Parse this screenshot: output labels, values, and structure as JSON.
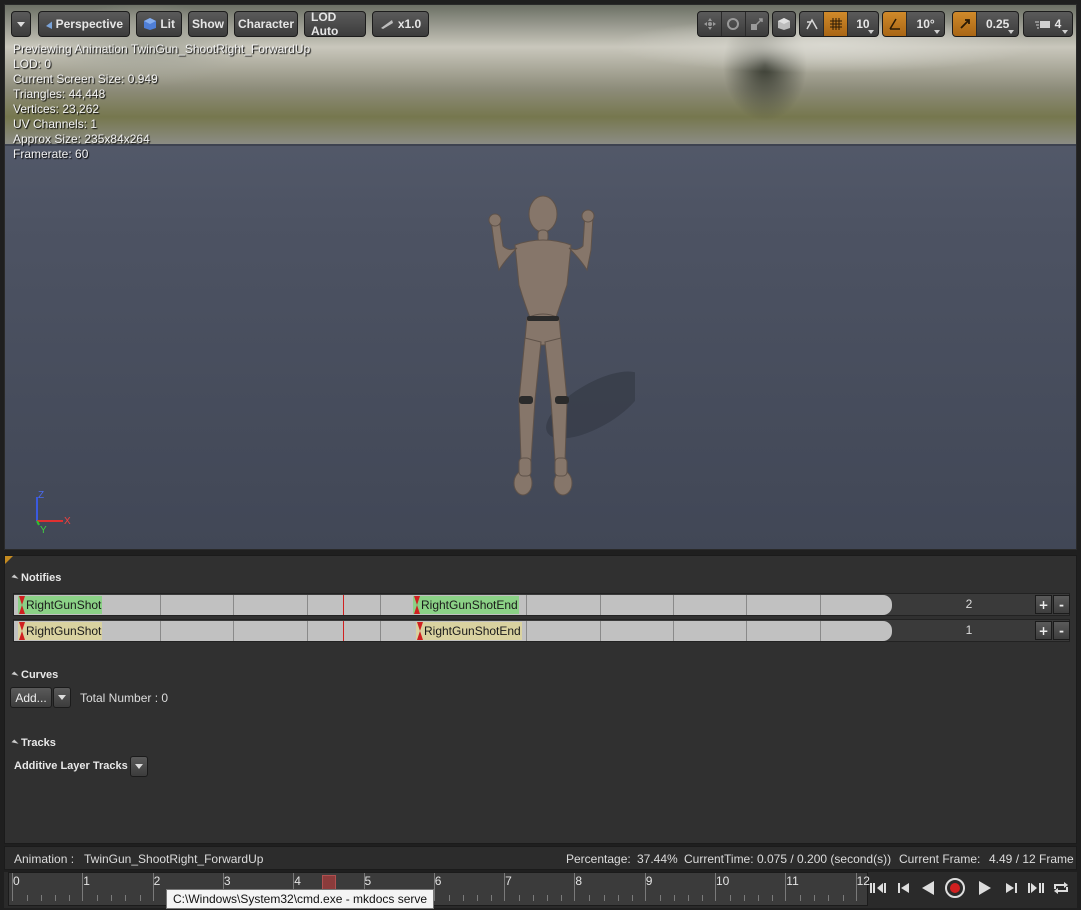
{
  "toolbar": {
    "menu_label": "",
    "perspective_label": "Perspective",
    "lit_label": "Lit",
    "show_label": "Show",
    "character_label": "Character",
    "lod_label": "LOD Auto",
    "speed_label": "x1.0",
    "grid_snap_value": "10",
    "rotation_snap_value": "10°",
    "scale_snap_value": "0.25",
    "camera_speed_value": "4"
  },
  "info": {
    "line1": "Previewing Animation TwinGun_ShootRight_ForwardUp",
    "line2": "LOD: 0",
    "line3": "Current Screen Size: 0.949",
    "line4": "Triangles: 44,448",
    "line5": "Vertices: 23,262",
    "line6": "UV Channels: 1",
    "line7": "Approx Size: 235x84x264",
    "line8": "Framerate: 60"
  },
  "axis": {
    "z": "Z",
    "x": "X",
    "y": "Y"
  },
  "notifies": {
    "title": "Notifies",
    "tracks": [
      {
        "start_label": "RightGunShot",
        "end_label": "RightGunShotEnd",
        "number": "2",
        "color": "#8bd186"
      },
      {
        "start_label": "RightGunShot",
        "end_label": "RightGunShotEnd",
        "number": "1",
        "color": "#d9d2a0"
      }
    ],
    "add_symbol": "+",
    "remove_symbol": "-"
  },
  "curves": {
    "title": "Curves",
    "add_label": "Add...",
    "total_label": "Total Number : 0"
  },
  "tracks": {
    "title": "Tracks",
    "additive_label": "Additive Layer Tracks"
  },
  "status": {
    "animation_label": "Animation :",
    "animation_name": "TwinGun_ShootRight_ForwardUp",
    "percentage_label": "Percentage:",
    "percentage_value": "37.44%",
    "time_label": "CurrentTime:",
    "time_value": "0.075 / 0.200 (second(s))",
    "frame_label": "Current Frame:",
    "frame_value": "4.49 / 12 Frame"
  },
  "timeline": {
    "ticks": [
      "0",
      "1",
      "2",
      "3",
      "4",
      "5",
      "6",
      "7",
      "8",
      "9",
      "10",
      "11",
      "12"
    ],
    "current_frame": 4.49,
    "total_frames": 12
  },
  "tooltip": {
    "text": "C:\\Windows\\System32\\cmd.exe - mkdocs  serve"
  },
  "colors": {
    "accent_orange": "#c17a20",
    "notify_green": "#8bd186",
    "notify_yellow": "#d9d2a0",
    "scrub_red": "#d02020"
  }
}
